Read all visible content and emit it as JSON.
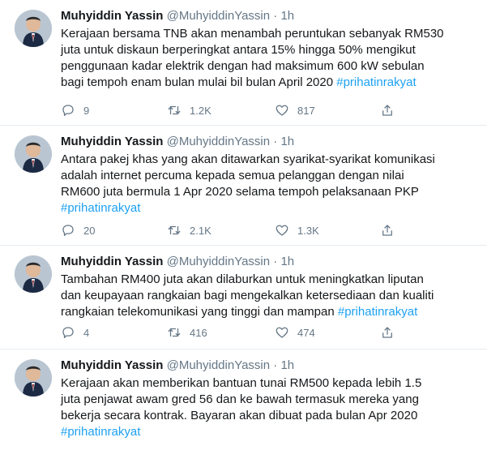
{
  "tweets": [
    {
      "author_name": "Muhyiddin Yassin",
      "handle": "@MuhyiddinYassin",
      "separator": "·",
      "time": "1h",
      "text": "Kerajaan bersama TNB akan menambah peruntukan sebanyak RM530\njuta untuk diskaun berperingkat antara 15% hingga 50% mengikut\npenggunaan kadar elektrik dengan had maksimum 600 kW sebulan\nbagi tempoh enam bulan mulai bil bulan April 2020 ",
      "hashtag": "#prihatinrakyat",
      "replies": "9",
      "retweets": "1.2K",
      "likes": "817"
    },
    {
      "author_name": "Muhyiddin Yassin",
      "handle": "@MuhyiddinYassin",
      "separator": "·",
      "time": "1h",
      "text": "Antara pakej khas yang akan ditawarkan syarikat-syarikat komunikasi\nadalah internet percuma kepada semua pelanggan dengan nilai\nRM600 juta bermula 1 Apr 2020 selama tempoh pelaksanaan PKP\n",
      "hashtag": "#prihatinrakyat",
      "replies": "20",
      "retweets": "2.1K",
      "likes": "1.3K"
    },
    {
      "author_name": "Muhyiddin Yassin",
      "handle": "@MuhyiddinYassin",
      "separator": "·",
      "time": "1h",
      "text": "Tambahan RM400 juta akan dilaburkan untuk meningkatkan liputan\ndan keupayaan rangkaian bagi mengekalkan ketersediaan dan kualiti\nrangkaian telekomunikasi yang tinggi dan mampan ",
      "hashtag": "#prihatinrakyat",
      "replies": "4",
      "retweets": "416",
      "likes": "474"
    },
    {
      "author_name": "Muhyiddin Yassin",
      "handle": "@MuhyiddinYassin",
      "separator": "·",
      "time": "1h",
      "text": "Kerajaan akan memberikan bantuan tunai RM500 kepada lebih 1.5\njuta penjawat awam gred 56 dan ke bawah termasuk mereka yang\nbekerja secara kontrak. Bayaran akan dibuat pada bulan Apr 2020\n",
      "hashtag": "#prihatinrakyat",
      "replies": "",
      "retweets": "",
      "likes": ""
    }
  ],
  "icons": {
    "reply": "reply-icon",
    "retweet": "retweet-icon",
    "like": "like-icon"
  },
  "colors": {
    "hashtag": "#1da1f2",
    "secondary_text": "#657786",
    "divider": "#e6ecf0"
  }
}
